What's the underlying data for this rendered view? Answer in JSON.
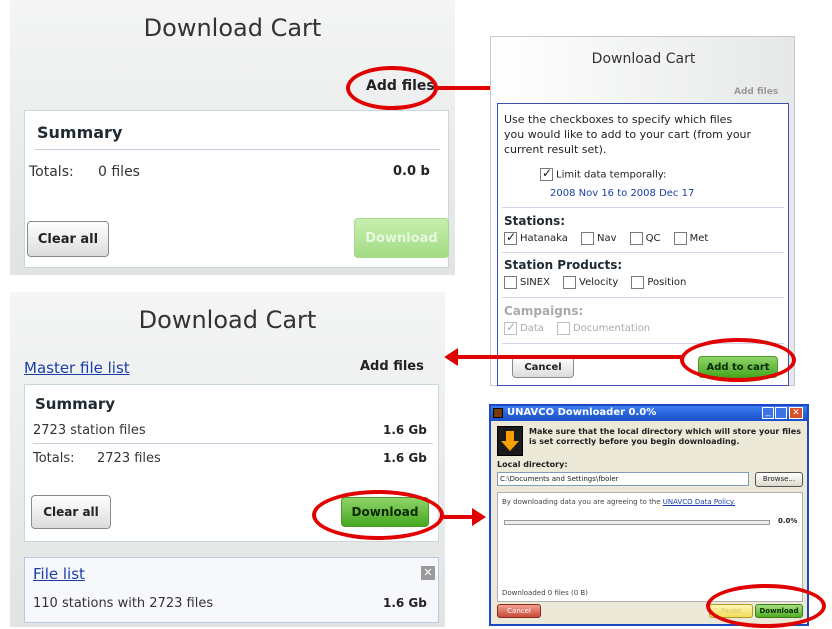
{
  "panel1": {
    "title": "Download Cart",
    "add_files": "Add files",
    "summary_heading": "Summary",
    "totals_label": "Totals:",
    "totals_files": "0 files",
    "totals_size": "0.0 b",
    "clear_all": "Clear all",
    "download": "Download"
  },
  "dialog": {
    "title": "Download Cart",
    "add_files": "Add files",
    "instructions": "Use the checkboxes to specify which files you would like to add to your cart (from your current result set).",
    "limit_label": "Limit data temporally:",
    "limit_checked": true,
    "date_range": "2008 Nov 16 to 2008 Dec 17",
    "stations_heading": "Stations:",
    "stations": [
      {
        "label": "Hatanaka",
        "checked": true
      },
      {
        "label": "Nav",
        "checked": false
      },
      {
        "label": "QC",
        "checked": false
      },
      {
        "label": "Met",
        "checked": false
      }
    ],
    "products_heading": "Station Products:",
    "products": [
      {
        "label": "SINEX",
        "checked": false
      },
      {
        "label": "Velocity",
        "checked": false
      },
      {
        "label": "Position",
        "checked": false
      }
    ],
    "campaigns_heading": "Campaigns:",
    "campaigns": [
      {
        "label": "Data",
        "checked": true
      },
      {
        "label": "Documentation",
        "checked": false
      }
    ],
    "cancel": "Cancel",
    "add_to_cart": "Add to cart"
  },
  "panel2": {
    "title": "Download Cart",
    "master_link": "Master file list",
    "add_files": "Add files",
    "summary_heading": "Summary",
    "station_files": "2723 station files",
    "station_size": "1.6 Gb",
    "totals_label": "Totals:",
    "totals_files": "2723 files",
    "totals_size": "1.6 Gb",
    "clear_all": "Clear all",
    "download": "Download",
    "file_list_link": "File list",
    "file_list_desc": "110 stations with 2723 files",
    "file_list_size": "1.6 Gb"
  },
  "downloader": {
    "title": "UNAVCO Downloader 0.0%",
    "message": "Make sure that the local directory which will store your files is set correctly before you begin downloading.",
    "local_dir_label": "Local directory:",
    "local_dir_value": "C:\\Documents and Settings\\fboler",
    "browse": "Browse...",
    "policy_text": "By downloading data you are agreeing to the",
    "policy_link": "UNAVCO Data Policy.",
    "progress_percent": "0.0%",
    "progress_value": 0,
    "status": "Downloaded 0 files (0 B)",
    "cancel": "Cancel",
    "pause": "Pause",
    "download": "Download"
  },
  "colors": {
    "annotation_red": "#e00000",
    "link_blue": "#1a3ea8",
    "green_button": "#46a81f",
    "xp_blue": "#2a5fd8"
  }
}
